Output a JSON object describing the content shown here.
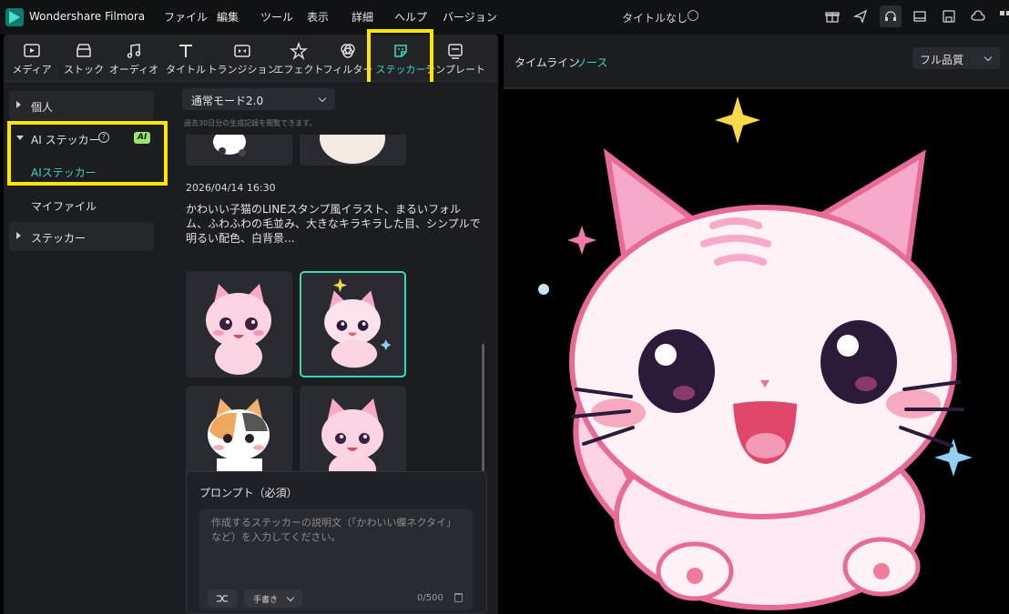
{
  "app": {
    "name": "Wondershare Filmora",
    "project_title": "タイトルなし"
  },
  "menu": [
    "ファイル",
    "編集",
    "ツール",
    "表示",
    "詳細",
    "ヘルプ",
    "バージョン"
  ],
  "toolbar_icons": [
    "gift-icon",
    "send-icon",
    "headset-icon",
    "layout-icon",
    "save-icon",
    "cloud-icon",
    "grid-icon"
  ],
  "tabs": [
    {
      "label": "メディア",
      "icon": "media-icon"
    },
    {
      "label": "ストック",
      "icon": "stock-icon"
    },
    {
      "label": "オーディオ",
      "icon": "audio-icon"
    },
    {
      "label": "タイトル",
      "icon": "title-icon"
    },
    {
      "label": "トランジション",
      "icon": "transition-icon"
    },
    {
      "label": "エフェクト",
      "icon": "effect-icon"
    },
    {
      "label": "フィルター",
      "icon": "filter-icon"
    },
    {
      "label": "ステッカー",
      "icon": "sticker-icon",
      "active": true
    },
    {
      "label": "テンプレート",
      "icon": "template-icon"
    }
  ],
  "sidebar": {
    "personal": "個人",
    "ai_sticker": "AI ステッカー",
    "ai_badge": "AI",
    "ai_sticker_sub": "AIステッカー",
    "my_files": "マイファイル",
    "stickers": "ステッカー"
  },
  "content": {
    "mode": "通常モード2.0",
    "history_note": "過去30日分の生成記録を閲覧できます。",
    "timestamp": "2026/04/14 16:30",
    "prompt_text": "かわいい子猫のLINEスタンプ風イラスト、まるいフォルム、ふわふわの毛並み、大きなキラキラした目、シンプルで明るい配色、白背景...",
    "prompt_title": "プロンプト（必須）",
    "prompt_placeholder": "作成するステッカーの説明文（「かわいい蝶ネクタイ」など）を入力してください。",
    "style_label": "手書き",
    "counter": "0/500"
  },
  "preview": {
    "tab_timeline": "タイムライン",
    "tab_source": "ソース",
    "quality": "フル品質"
  },
  "colors": {
    "accent": "#3dd6b8",
    "highlight": "#ffe600",
    "badge": "#9be36b"
  }
}
